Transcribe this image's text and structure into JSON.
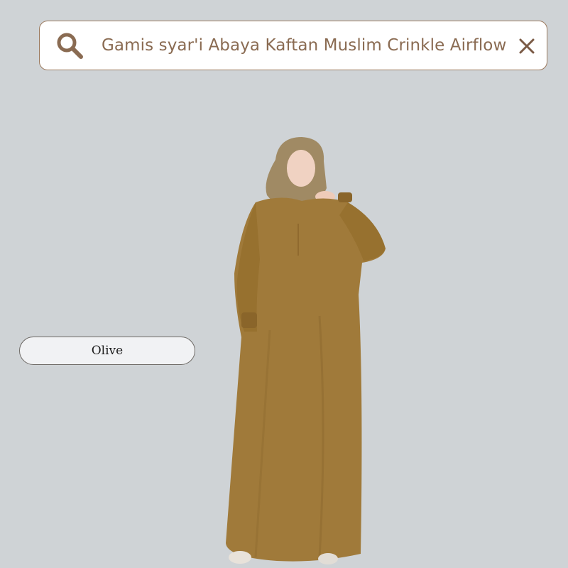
{
  "search": {
    "query": "Gamis syar'i Abaya Kaftan Muslim Crinkle Airflow",
    "search_icon": "search-icon",
    "clear_icon": "close-icon"
  },
  "variant": {
    "label": "Olive"
  },
  "product_image": {
    "color": "#a07a3a"
  },
  "colors": {
    "background": "#cfd3d6",
    "accent_brown": "#8a6b52"
  }
}
